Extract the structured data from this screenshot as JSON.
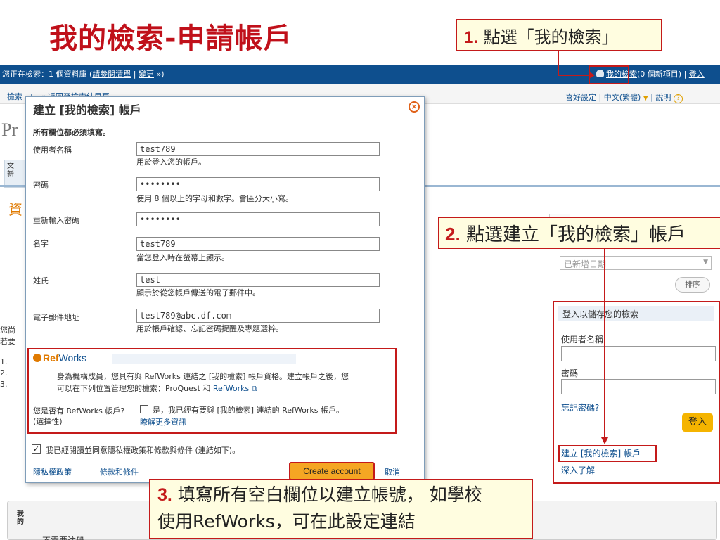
{
  "slide": {
    "title": "我的檢索-申請帳戶",
    "callout1": {
      "num": "1.",
      "text": " 點選「我的檢索」"
    },
    "callout2": {
      "num": "2.",
      "text": " 點選建立「我的檢索」帳戶"
    },
    "callout3": {
      "num": "3.",
      "text_line1": " 填寫所有空白欄位以建立帳號， 如學校",
      "text_line2": "使用RefWorks，可在此設定連結"
    }
  },
  "topbar": {
    "left_prefix": "您正在檢索：1 個資料庫 (",
    "select_db": "請參閱清單",
    "sep": " | ",
    "change": "變更",
    "left_suffix": " »)",
    "my_research": "我的檢索",
    "my_research_count": "(0 個新項目)",
    "sep2": " | ",
    "login": "登入"
  },
  "subbar": {
    "breadcrumb": "檢索　|　« 返回至檢索結果頁",
    "prefs": "喜好設定",
    "lang": "中文(繁體)",
    "help": "說明",
    "help_icon": "?"
  },
  "background": {
    "logo": "Pr",
    "tab_line1": "文",
    "tab_line2": "新",
    "section": "資",
    "left_text_1": "您尚",
    "left_text_2": "若要",
    "left_list": [
      "1.",
      "2.",
      "3."
    ],
    "bottom_label": "我的",
    "bottom_text": "不需要注册"
  },
  "sort": {
    "selected": "已新增日期",
    "button": "排序"
  },
  "login_panel": {
    "heading": "登入以儲存您的檢索",
    "username_label": "使用者名稱",
    "password_label": "密碼",
    "forgot": "忘記密碼?",
    "login_button": "登入",
    "create_link": "建立 [我的檢索] 帳戶",
    "learn_more": "深入了解"
  },
  "modal": {
    "title": "建立 [我的檢索] 帳戶",
    "close_glyph": "×",
    "required": "所有欄位都必須填寫。",
    "fields": {
      "username": {
        "label": "使用者名稱",
        "value": "test789",
        "hint": "用於登入您的帳戶。"
      },
      "password": {
        "label": "密碼",
        "value": "••••••••",
        "hint": "使用 8 個以上的字母和數字。會區分大小寫。"
      },
      "password2": {
        "label": "重新輸入密碼",
        "value": "••••••••"
      },
      "firstname": {
        "label": "名字",
        "value": "test789",
        "hint": "當您登入時在螢幕上顯示。"
      },
      "lastname": {
        "label": "姓氏",
        "value": "test",
        "hint": "顯示於從您帳戶傳送的電子郵件中。"
      },
      "email": {
        "label": "電子郵件地址",
        "value": "test789@abc.df.com",
        "hint": "用於帳戶確認、忘記密碼提醒及專題選粹。"
      }
    },
    "refworks": {
      "logo_a": "Ref",
      "logo_b": "Works",
      "desc_1": "身為機構成員，您具有與 RefWorks 連結之 [我的檢索] 帳戶資格。建立帳戶之後，您",
      "desc_2": "可以在下列位置管理您的檢索：ProQuest 和 ",
      "desc_link": "RefWorks",
      "question": "您是否有 RefWorks 帳戶? (選擇性)",
      "yes_text": "是，我已經有要與 [我的檢索] 連結的 RefWorks 帳戶。",
      "more": "瞭解更多資訊"
    },
    "agree_glyph": "✓",
    "agree": "我已經閱讀並同意隱私權政策和條款與條件 (連結如下)。",
    "privacy": "隱私權政策",
    "terms": "條款和條件",
    "create": "Create account",
    "cancel": "取消"
  }
}
